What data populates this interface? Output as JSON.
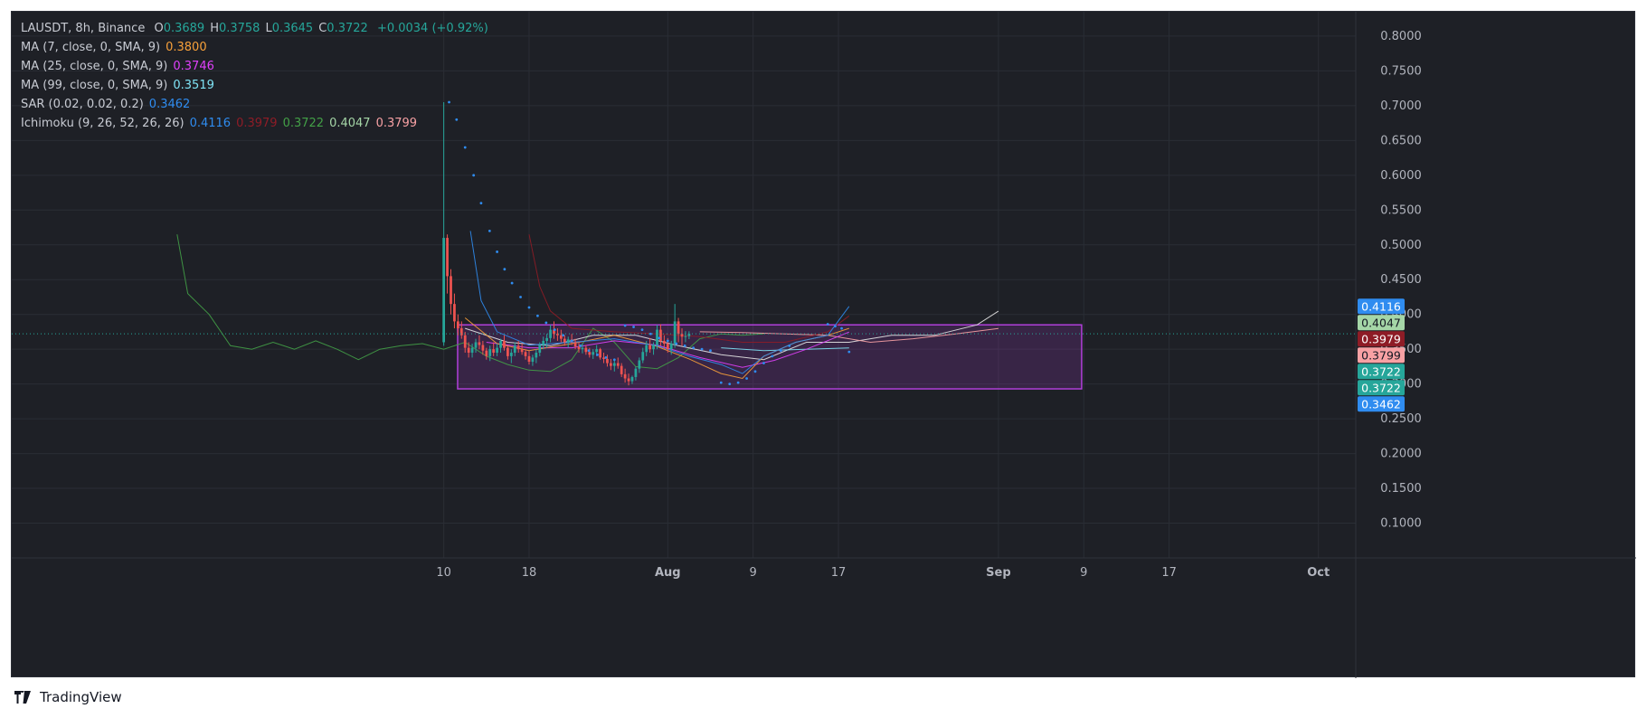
{
  "brand": {
    "logo_icon": "tradingview-logo-icon",
    "name": "TradingView"
  },
  "header": {
    "symbol_line": "LAUSDT, 8h, Binance",
    "ohlc": [
      {
        "label": "O",
        "value": "0.3689"
      },
      {
        "label": "H",
        "value": "0.3758"
      },
      {
        "label": "L",
        "value": "0.3645"
      },
      {
        "label": "C",
        "value": "0.3722"
      }
    ],
    "change": "+0.0034 (+0.92%)",
    "up_color": "#26a69a",
    "down_color": "#ef5350"
  },
  "indicators": [
    {
      "label": "MA (7, close, 0, SMA, 9)",
      "values": [
        {
          "text": "0.3800",
          "color": "#f7a03a"
        }
      ]
    },
    {
      "label": "MA (25, close, 0, SMA, 9)",
      "values": [
        {
          "text": "0.3746",
          "color": "#e040fb"
        }
      ]
    },
    {
      "label": "MA (99, close, 0, SMA, 9)",
      "values": [
        {
          "text": "0.3519",
          "color": "#7fe3f5"
        }
      ]
    },
    {
      "label": "SAR (0.02, 0.02, 0.2)",
      "values": [
        {
          "text": "0.3462",
          "color": "#2f8cf0"
        }
      ]
    },
    {
      "label": "Ichimoku (9, 26, 52, 26, 26)",
      "values": [
        {
          "text": "0.4116",
          "color": "#2f8cf0"
        },
        {
          "text": "0.3979",
          "color": "#8e1c26"
        },
        {
          "text": "0.3722",
          "color": "#43a047"
        },
        {
          "text": "0.4047",
          "color": "#a5d6a7"
        },
        {
          "text": "0.3799",
          "color": "#f8a1a4"
        }
      ]
    }
  ],
  "chart_data": {
    "type": "candlestick",
    "timeframe": "8h",
    "y_axis": {
      "ticks": [
        "0.8000",
        "0.7500",
        "0.7000",
        "0.6500",
        "0.6000",
        "0.5500",
        "0.5000",
        "0.4500",
        "0.4000",
        "0.3500",
        "0.3000",
        "0.2500",
        "0.2000",
        "0.1500",
        "0.1000"
      ],
      "range": [
        0.05,
        0.835
      ]
    },
    "x_axis": {
      "ticks": [
        {
          "label": "10",
          "t": 10
        },
        {
          "label": "18",
          "t": 18
        },
        {
          "label": "Aug",
          "t": 31,
          "bold": true
        },
        {
          "label": "9",
          "t": 39
        },
        {
          "label": "17",
          "t": 47
        },
        {
          "label": "Sep",
          "t": 62,
          "bold": true
        },
        {
          "label": "9",
          "t": 70
        },
        {
          "label": "17",
          "t": 78
        },
        {
          "label": "Oct",
          "t": 92,
          "bold": true
        }
      ],
      "range": [
        -30.5,
        95.5
      ]
    },
    "price_labels": [
      {
        "text": "0.4116",
        "value": 0.4116,
        "bg": "#2f8cf0",
        "fg": "#ffffff"
      },
      {
        "text": "0.4047",
        "value": 0.4047,
        "bg": "#a5d6a7",
        "fg": "#131722"
      },
      {
        "text": "0.3979",
        "value": 0.3979,
        "bg": "#8e1c26",
        "fg": "#ffffff"
      },
      {
        "text": "0.3799",
        "value": 0.3799,
        "bg": "#f8a1a4",
        "fg": "#131722"
      },
      {
        "text": "0.3722",
        "value": 0.3722,
        "bg": "#26a69a",
        "fg": "#ffffff"
      },
      {
        "text": "0.3722",
        "value": 0.3722,
        "bg": "#26a69a",
        "fg": "#ffffff"
      },
      {
        "text": "0.3462",
        "value": 0.3462,
        "bg": "#2f8cf0",
        "fg": "#ffffff"
      }
    ],
    "last_price": 0.3722,
    "range_box": {
      "t_start": 11.3,
      "t_end": 69.8,
      "top": 0.385,
      "bottom": 0.293,
      "color": "#b03fd9"
    },
    "candles": {
      "t_start": 10.0,
      "t_step": 0.3333,
      "ohlc": [
        [
          0.36,
          0.705,
          0.355,
          0.51
        ],
        [
          0.51,
          0.515,
          0.43,
          0.455
        ],
        [
          0.455,
          0.465,
          0.4,
          0.415
        ],
        [
          0.415,
          0.43,
          0.38,
          0.39
        ],
        [
          0.39,
          0.4,
          0.37,
          0.38
        ],
        [
          0.38,
          0.39,
          0.365,
          0.37
        ],
        [
          0.37,
          0.375,
          0.345,
          0.352
        ],
        [
          0.352,
          0.36,
          0.338,
          0.345
        ],
        [
          0.345,
          0.358,
          0.338,
          0.352
        ],
        [
          0.352,
          0.365,
          0.345,
          0.36
        ],
        [
          0.36,
          0.37,
          0.35,
          0.356
        ],
        [
          0.356,
          0.362,
          0.342,
          0.348
        ],
        [
          0.348,
          0.352,
          0.335,
          0.34
        ],
        [
          0.34,
          0.355,
          0.333,
          0.35
        ],
        [
          0.35,
          0.36,
          0.34,
          0.345
        ],
        [
          0.345,
          0.358,
          0.34,
          0.352
        ],
        [
          0.352,
          0.365,
          0.345,
          0.362
        ],
        [
          0.362,
          0.37,
          0.348,
          0.352
        ],
        [
          0.352,
          0.355,
          0.335,
          0.34
        ],
        [
          0.34,
          0.35,
          0.33,
          0.345
        ],
        [
          0.345,
          0.36,
          0.34,
          0.355
        ],
        [
          0.355,
          0.362,
          0.345,
          0.35
        ],
        [
          0.35,
          0.358,
          0.342,
          0.346
        ],
        [
          0.346,
          0.35,
          0.335,
          0.34
        ],
        [
          0.34,
          0.348,
          0.328,
          0.332
        ],
        [
          0.332,
          0.342,
          0.326,
          0.338
        ],
        [
          0.338,
          0.35,
          0.33,
          0.345
        ],
        [
          0.345,
          0.36,
          0.34,
          0.356
        ],
        [
          0.356,
          0.368,
          0.35,
          0.362
        ],
        [
          0.362,
          0.372,
          0.352,
          0.366
        ],
        [
          0.366,
          0.385,
          0.36,
          0.378
        ],
        [
          0.378,
          0.39,
          0.365,
          0.372
        ],
        [
          0.372,
          0.38,
          0.362,
          0.37
        ],
        [
          0.37,
          0.378,
          0.36,
          0.365
        ],
        [
          0.365,
          0.37,
          0.355,
          0.36
        ],
        [
          0.36,
          0.368,
          0.352,
          0.364
        ],
        [
          0.364,
          0.372,
          0.356,
          0.36
        ],
        [
          0.36,
          0.365,
          0.35,
          0.354
        ],
        [
          0.354,
          0.36,
          0.345,
          0.35
        ],
        [
          0.35,
          0.358,
          0.344,
          0.352
        ],
        [
          0.352,
          0.356,
          0.342,
          0.346
        ],
        [
          0.346,
          0.352,
          0.338,
          0.342
        ],
        [
          0.342,
          0.35,
          0.336,
          0.346
        ],
        [
          0.346,
          0.356,
          0.34,
          0.35
        ],
        [
          0.35,
          0.352,
          0.335,
          0.338
        ],
        [
          0.338,
          0.345,
          0.33,
          0.336
        ],
        [
          0.336,
          0.342,
          0.325,
          0.33
        ],
        [
          0.33,
          0.336,
          0.32,
          0.326
        ],
        [
          0.326,
          0.334,
          0.318,
          0.33
        ],
        [
          0.33,
          0.338,
          0.322,
          0.326
        ],
        [
          0.326,
          0.33,
          0.31,
          0.314
        ],
        [
          0.314,
          0.322,
          0.302,
          0.308
        ],
        [
          0.308,
          0.315,
          0.298,
          0.304
        ],
        [
          0.304,
          0.312,
          0.3,
          0.31
        ],
        [
          0.31,
          0.325,
          0.305,
          0.322
        ],
        [
          0.322,
          0.338,
          0.316,
          0.334
        ],
        [
          0.334,
          0.352,
          0.33,
          0.346
        ],
        [
          0.346,
          0.362,
          0.34,
          0.356
        ],
        [
          0.356,
          0.366,
          0.345,
          0.35
        ],
        [
          0.35,
          0.36,
          0.342,
          0.356
        ],
        [
          0.356,
          0.385,
          0.35,
          0.378
        ],
        [
          0.378,
          0.386,
          0.355,
          0.362
        ],
        [
          0.362,
          0.37,
          0.35,
          0.358
        ],
        [
          0.358,
          0.366,
          0.345,
          0.35
        ],
        [
          0.35,
          0.362,
          0.342,
          0.358
        ],
        [
          0.358,
          0.415,
          0.352,
          0.39
        ],
        [
          0.39,
          0.395,
          0.36,
          0.372
        ],
        [
          0.372,
          0.38,
          0.355,
          0.368
        ],
        [
          0.368,
          0.376,
          0.36,
          0.3689
        ],
        [
          0.3689,
          0.3758,
          0.3645,
          0.3722
        ]
      ]
    },
    "lines": {
      "ma7": {
        "color": "#f7a03a",
        "points": [
          [
            12,
            0.395
          ],
          [
            15,
            0.358
          ],
          [
            18,
            0.348
          ],
          [
            22,
            0.358
          ],
          [
            26,
            0.37
          ],
          [
            30,
            0.354
          ],
          [
            33,
            0.336
          ],
          [
            36,
            0.315
          ],
          [
            38,
            0.308
          ],
          [
            40,
            0.34
          ],
          [
            43,
            0.36
          ],
          [
            46,
            0.37
          ],
          [
            48,
            0.38
          ]
        ]
      },
      "ma25": {
        "color": "#e040fb",
        "points": [
          [
            14,
            0.36
          ],
          [
            18,
            0.352
          ],
          [
            22,
            0.352
          ],
          [
            26,
            0.362
          ],
          [
            30,
            0.356
          ],
          [
            34,
            0.338
          ],
          [
            38,
            0.324
          ],
          [
            41,
            0.334
          ],
          [
            44,
            0.35
          ],
          [
            48,
            0.3746
          ]
        ]
      },
      "ma99": {
        "color": "#7fe3f5",
        "points": [
          [
            36,
            0.352
          ],
          [
            40,
            0.348
          ],
          [
            44,
            0.35
          ],
          [
            48,
            0.3519
          ]
        ]
      },
      "tenkan": {
        "color": "#2f8cf0",
        "points": [
          [
            12.5,
            0.52
          ],
          [
            13.5,
            0.42
          ],
          [
            15,
            0.375
          ],
          [
            18,
            0.356
          ],
          [
            22,
            0.36
          ],
          [
            26,
            0.365
          ],
          [
            30,
            0.355
          ],
          [
            33,
            0.34
          ],
          [
            36,
            0.328
          ],
          [
            38,
            0.315
          ],
          [
            40,
            0.34
          ],
          [
            43,
            0.36
          ],
          [
            46,
            0.37
          ],
          [
            48,
            0.4116
          ]
        ]
      },
      "kijun": {
        "color": "#8e1c26",
        "points": [
          [
            18,
            0.515
          ],
          [
            19,
            0.44
          ],
          [
            20,
            0.405
          ],
          [
            22,
            0.38
          ],
          [
            26,
            0.375
          ],
          [
            30,
            0.372
          ],
          [
            34,
            0.368
          ],
          [
            38,
            0.36
          ],
          [
            42,
            0.36
          ],
          [
            46,
            0.375
          ],
          [
            48,
            0.3979
          ]
        ]
      },
      "lagging": {
        "color": "#43a047",
        "points": [
          [
            -15,
            0.515
          ],
          [
            -14,
            0.43
          ],
          [
            -12,
            0.4
          ],
          [
            -10,
            0.355
          ],
          [
            -8,
            0.35
          ],
          [
            -6,
            0.36
          ],
          [
            -4,
            0.35
          ],
          [
            -2,
            0.362
          ],
          [
            0,
            0.35
          ],
          [
            2,
            0.335
          ],
          [
            4,
            0.35
          ],
          [
            6,
            0.355
          ],
          [
            8,
            0.358
          ],
          [
            10,
            0.35
          ],
          [
            12,
            0.36
          ],
          [
            14,
            0.34
          ],
          [
            16,
            0.328
          ],
          [
            18,
            0.32
          ],
          [
            20,
            0.318
          ],
          [
            22,
            0.335
          ],
          [
            24,
            0.38
          ],
          [
            26,
            0.36
          ],
          [
            28,
            0.325
          ],
          [
            30,
            0.322
          ],
          [
            32,
            0.338
          ],
          [
            34,
            0.365
          ],
          [
            36,
            0.372
          ],
          [
            38,
            0.37
          ],
          [
            40,
            0.3722
          ]
        ]
      },
      "span_a": {
        "color": "#e6e6e6",
        "points": [
          [
            12,
            0.38
          ],
          [
            16,
            0.36
          ],
          [
            20,
            0.355
          ],
          [
            24,
            0.37
          ],
          [
            28,
            0.37
          ],
          [
            32,
            0.355
          ],
          [
            36,
            0.342
          ],
          [
            40,
            0.335
          ],
          [
            44,
            0.36
          ],
          [
            48,
            0.36
          ],
          [
            52,
            0.37
          ],
          [
            56,
            0.37
          ],
          [
            60,
            0.385
          ],
          [
            62,
            0.4047
          ]
        ]
      },
      "span_b": {
        "color": "#f8a1a4",
        "points": [
          [
            34,
            0.375
          ],
          [
            38,
            0.374
          ],
          [
            42,
            0.372
          ],
          [
            46,
            0.37
          ],
          [
            50,
            0.36
          ],
          [
            54,
            0.365
          ],
          [
            58,
            0.372
          ],
          [
            62,
            0.3799
          ]
        ]
      },
      "sar": {
        "color": "#2f8cf0",
        "points": [
          [
            10.5,
            0.705
          ],
          [
            11.2,
            0.68
          ],
          [
            12,
            0.64
          ],
          [
            12.8,
            0.6
          ],
          [
            13.5,
            0.56
          ],
          [
            14.3,
            0.52
          ],
          [
            15,
            0.49
          ],
          [
            15.7,
            0.465
          ],
          [
            16.4,
            0.445
          ],
          [
            17.2,
            0.425
          ],
          [
            18,
            0.41
          ],
          [
            18.8,
            0.398
          ],
          [
            19.6,
            0.388
          ],
          [
            20.4,
            0.378
          ],
          [
            21.2,
            0.37
          ],
          [
            22,
            0.362
          ],
          [
            22.8,
            0.355
          ],
          [
            23.6,
            0.348
          ],
          [
            24.4,
            0.342
          ],
          [
            25.2,
            0.338
          ],
          [
            26,
            0.335
          ],
          [
            27,
            0.384
          ],
          [
            27.8,
            0.382
          ],
          [
            28.6,
            0.378
          ],
          [
            29.4,
            0.372
          ],
          [
            30.2,
            0.366
          ],
          [
            31,
            0.362
          ],
          [
            31.8,
            0.358
          ],
          [
            32.6,
            0.355
          ],
          [
            33.4,
            0.352
          ],
          [
            34.2,
            0.35
          ],
          [
            35,
            0.348
          ],
          [
            36,
            0.302
          ],
          [
            36.8,
            0.3
          ],
          [
            37.6,
            0.302
          ],
          [
            38.4,
            0.308
          ],
          [
            39.2,
            0.318
          ],
          [
            40,
            0.33
          ],
          [
            40.8,
            0.34
          ],
          [
            41.6,
            0.348
          ],
          [
            42.4,
            0.355
          ],
          [
            46,
            0.386
          ],
          [
            46.7,
            0.383
          ],
          [
            47.3,
            0.38
          ],
          [
            48,
            0.3462
          ]
        ]
      }
    }
  }
}
